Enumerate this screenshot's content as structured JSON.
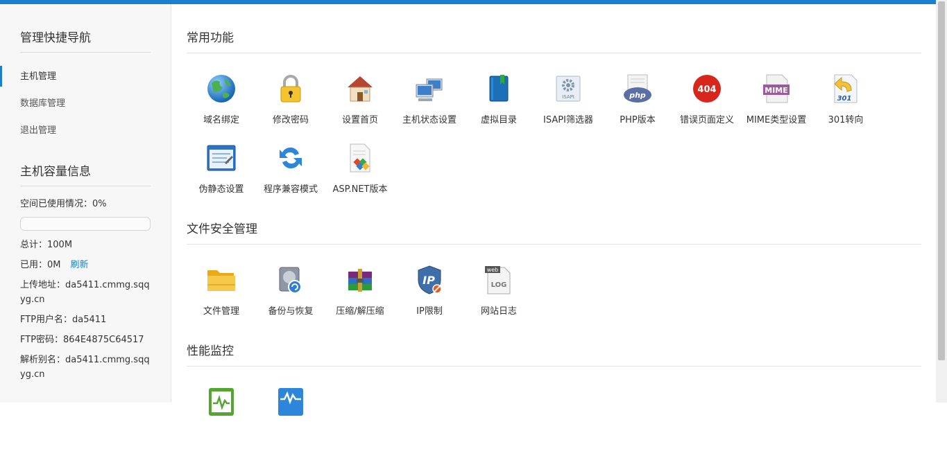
{
  "sidebar": {
    "quick_nav_title": "管理快捷导航",
    "nav": [
      {
        "label": "主机管理",
        "active": true
      },
      {
        "label": "数据库管理",
        "active": false
      },
      {
        "label": "退出管理",
        "active": false
      }
    ],
    "capacity_title": "主机容量信息",
    "space_used": "空间已使用情况：0%",
    "space_used_fraction": 0,
    "total": "总计：100M",
    "used": "已用：0M",
    "refresh": "刷新",
    "upload_address": "上传地址：da5411.cmmg.sqqyg.cn",
    "ftp_user": "FTP用户名：da5411",
    "ftp_password": "FTP密码：864E4875C64517",
    "alias": "解析别名：da5411.cmmg.sqqyg.cn"
  },
  "sections": {
    "common": {
      "title": "常用功能",
      "items": [
        {
          "label": "域名绑定",
          "icon": "globe-icon"
        },
        {
          "label": "修改密码",
          "icon": "padlock-icon"
        },
        {
          "label": "设置首页",
          "icon": "house-icon"
        },
        {
          "label": "主机状态设置",
          "icon": "computers-icon"
        },
        {
          "label": "虚拟目录",
          "icon": "book-icon"
        },
        {
          "label": "ISAPI筛选器",
          "icon": "isapi-gear-icon"
        },
        {
          "label": "PHP版本",
          "icon": "php-icon"
        },
        {
          "label": "错误页面定义",
          "icon": "404-icon"
        },
        {
          "label": "MIME类型设置",
          "icon": "mime-icon"
        },
        {
          "label": "301转向",
          "icon": "redirect-301-icon"
        },
        {
          "label": "伪静态设置",
          "icon": "config-window-icon"
        },
        {
          "label": "程序兼容模式",
          "icon": "refresh-arrows-icon"
        },
        {
          "label": "ASP.NET版本",
          "icon": "aspnet-document-icon"
        }
      ],
      "icon_texts": {
        "isapi": "ISAPI",
        "php": "php",
        "e404": "404",
        "mime": "MIME",
        "r301": "301"
      }
    },
    "security": {
      "title": "文件安全管理",
      "items": [
        {
          "label": "文件管理",
          "icon": "folder-icon"
        },
        {
          "label": "备份与恢复",
          "icon": "backup-drive-icon"
        },
        {
          "label": "压缩/解压缩",
          "icon": "archive-books-icon"
        },
        {
          "label": "IP限制",
          "icon": "ip-shield-icon"
        },
        {
          "label": "网站日志",
          "icon": "web-log-icon"
        }
      ],
      "icon_texts": {
        "ip": "IP",
        "web": "web",
        "log": "LOG"
      }
    },
    "performance": {
      "title": "性能监控",
      "items": [
        {
          "icon": "green-monitor-icon"
        },
        {
          "icon": "blue-monitor-icon"
        }
      ]
    }
  },
  "colors": {
    "accent": "#1a7fd0"
  }
}
